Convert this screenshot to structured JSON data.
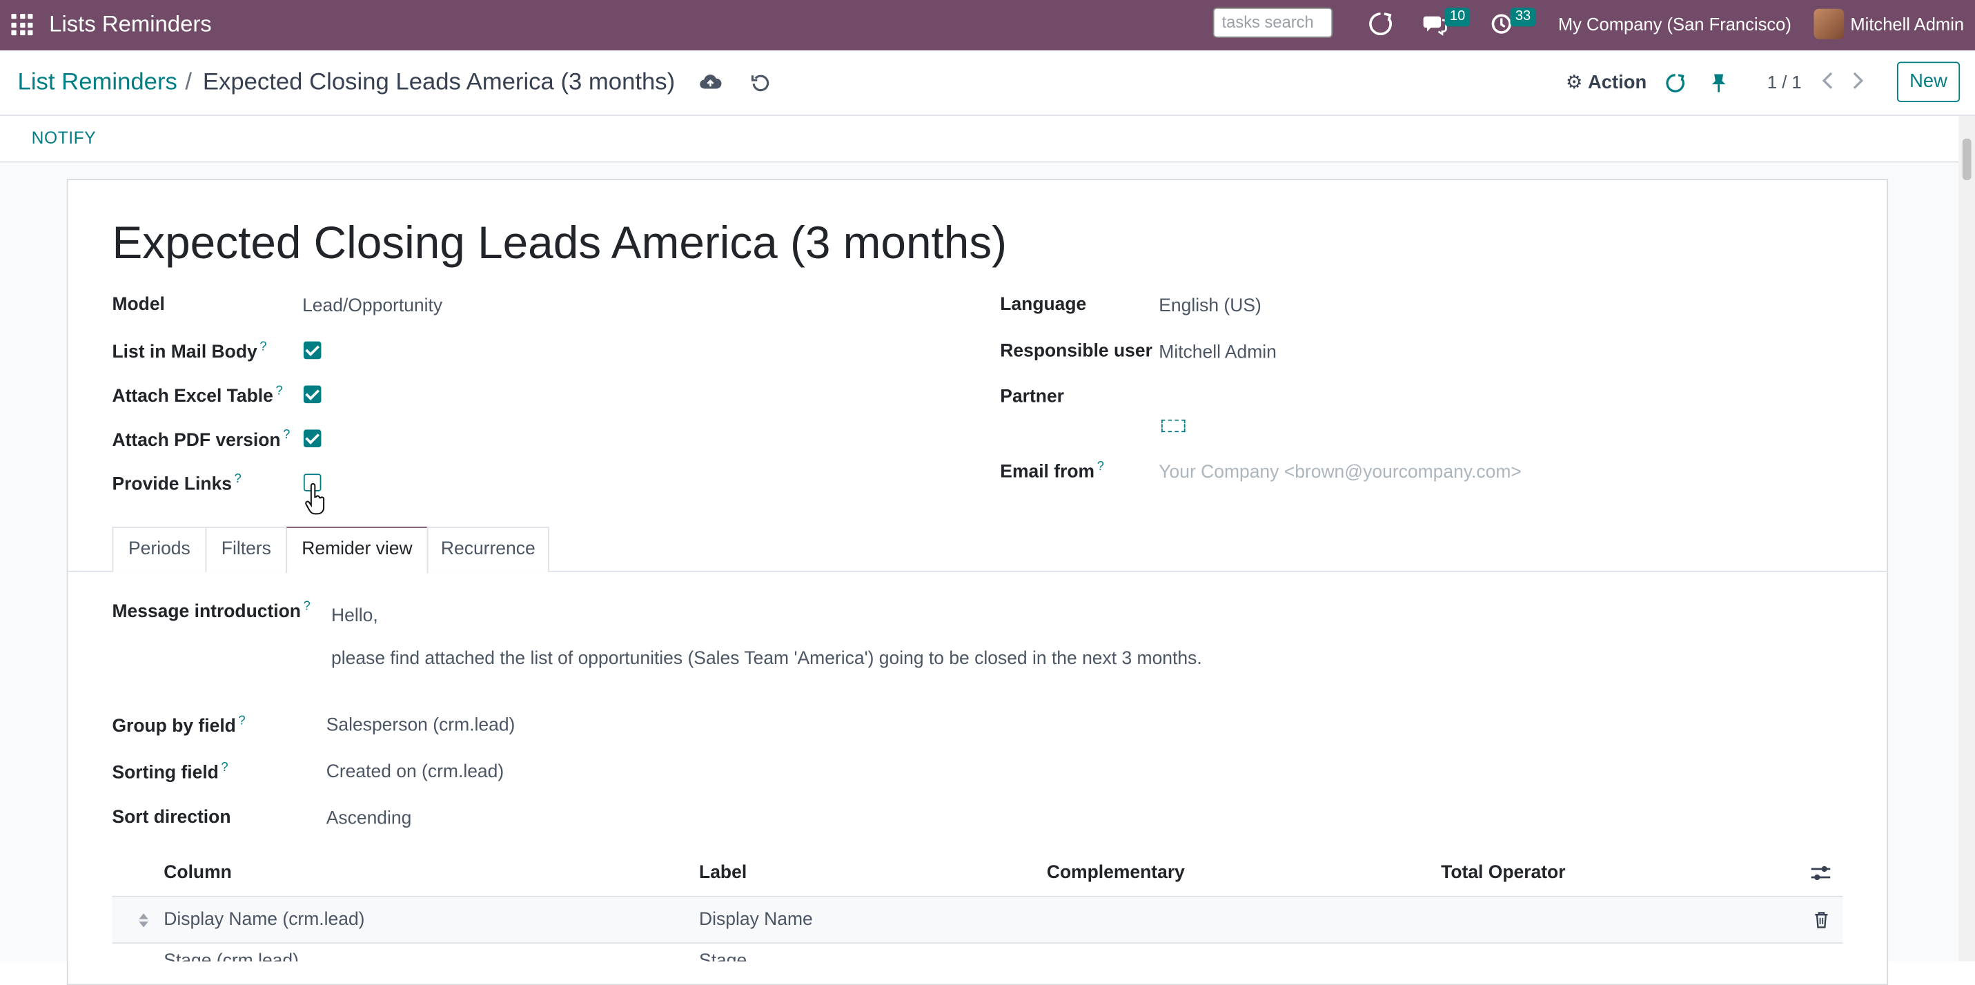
{
  "topbar": {
    "app_title": "Lists Reminders",
    "search_placeholder": "tasks search",
    "messages_count": "10",
    "activities_count": "33",
    "company": "My Company (San Francisco)",
    "user": "Mitchell Admin",
    "bar_color": "#714B67"
  },
  "breadcrumb": {
    "parent": "List Reminders",
    "separator": "/",
    "current": "Expected Closing Leads America (3 months)"
  },
  "control": {
    "action_label": "Action",
    "pager": "1 / 1",
    "new_label": "New"
  },
  "statusbar": {
    "notify_label": "NOTIFY"
  },
  "form": {
    "title": "Expected Closing Leads America (3 months)",
    "left": {
      "model_label": "Model",
      "model_value": "Lead/Opportunity",
      "list_in_mail_body_label": "List in Mail Body",
      "list_in_mail_body": true,
      "attach_excel_label": "Attach Excel Table",
      "attach_excel": true,
      "attach_pdf_label": "Attach PDF version",
      "attach_pdf": true,
      "provide_links_label": "Provide Links",
      "provide_links": false
    },
    "right": {
      "language_label": "Language",
      "language_value": "English (US)",
      "responsible_label": "Responsible user",
      "responsible_value": "Mitchell Admin",
      "partner_label": "Partner",
      "partner_value": "",
      "email_from_label": "Email from",
      "email_from_placeholder": "Your Company <brown@yourcompany.com>"
    },
    "help_marker": "?"
  },
  "tabs": [
    {
      "label": "Periods",
      "active": false
    },
    {
      "label": "Filters",
      "active": false
    },
    {
      "label": "Remider view",
      "active": true
    },
    {
      "label": "Recurrence",
      "active": false
    }
  ],
  "reminder_view": {
    "intro_label": "Message introduction",
    "intro_line1": "Hello,",
    "intro_line2": "please find attached the list of opportunities (Sales Team 'America') going to be closed in the next 3 months.",
    "group_by_label": "Group by field",
    "group_by_value": "Salesperson (crm.lead)",
    "sorting_label": "Sorting field",
    "sorting_value": "Created on (crm.lead)",
    "sort_dir_label": "Sort direction",
    "sort_dir_value": "Ascending"
  },
  "columns_table": {
    "headers": [
      "Column",
      "Label",
      "Complementary",
      "Total Operator"
    ],
    "rows": [
      {
        "column": "Display Name (crm.lead)",
        "label": "Display Name",
        "complementary": "",
        "total_operator": ""
      },
      {
        "column": "Stage (crm.lead)",
        "label": "Stage",
        "complementary": "",
        "total_operator": ""
      }
    ]
  },
  "colors": {
    "accent": "#017E84",
    "brand": "#714B67"
  }
}
